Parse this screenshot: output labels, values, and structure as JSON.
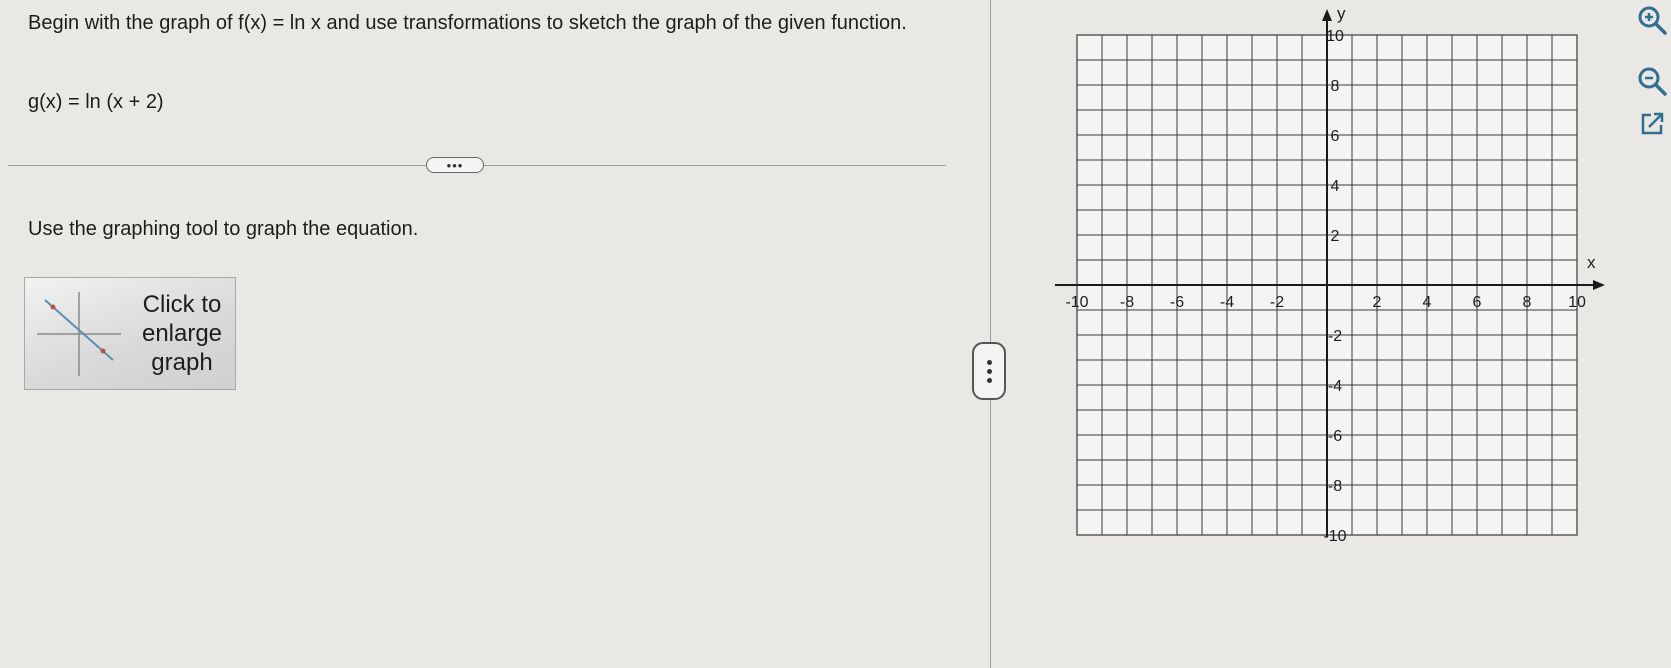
{
  "question": {
    "prompt": "Begin with the graph of f(x) = ln x and use transformations to sketch the graph of the given function.",
    "equation": "g(x) = ln (x + 2)",
    "more_button": "•••",
    "instruction": "Use the graphing tool to graph the equation.",
    "enlarge_label": "Click to\nenlarge\ngraph"
  },
  "graph": {
    "x_axis_label": "x",
    "y_axis_label": "y",
    "x_range": [
      -10,
      10
    ],
    "y_range": [
      -10,
      10
    ],
    "grid_step": 1,
    "x_tick_labels": [
      "-10",
      "-8",
      "-6",
      "-4",
      "-2",
      "2",
      "4",
      "6",
      "8",
      "10"
    ],
    "y_tick_labels": [
      "10",
      "8",
      "6",
      "4",
      "2",
      "-2",
      "-4",
      "-6",
      "-8",
      "-10"
    ]
  },
  "toolbar": {
    "zoom_in": "zoom-in-icon",
    "zoom_out": "zoom-out-icon",
    "popout": "external-link-icon",
    "accent_color": "#2f6f8f"
  }
}
